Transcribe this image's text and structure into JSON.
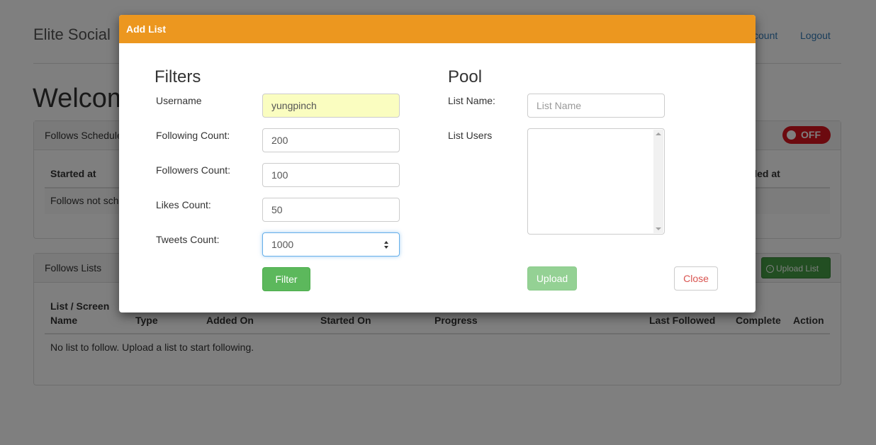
{
  "app": {
    "brand": "Elite Social",
    "nav": {
      "account": "count",
      "logout": "Logout"
    },
    "welcome": "Welcom"
  },
  "schedule_panel": {
    "title": "Follows Schedule",
    "toggle_label": "OFF",
    "columns": {
      "started": "Started at",
      "ended": "nded at"
    },
    "empty_text": "Follows not sch"
  },
  "lists_panel": {
    "title": "Follows Lists",
    "upload_button": "Upload List",
    "columns": {
      "list_line1": "List / Screen",
      "list_line2": "Name",
      "type": "Type",
      "added_on": "Added On",
      "started_on": "Started On",
      "progress": "Progress",
      "last_followed": "Last Followed",
      "complete": "Complete",
      "action": "Action"
    },
    "empty_text": "No list to follow. Upload a list to start following."
  },
  "modal": {
    "title": "Add List",
    "filters": {
      "heading": "Filters",
      "username_label": "Username",
      "username_value": "yungpinch",
      "following_label": "Following Count:",
      "following_value": "200",
      "followers_label": "Followers Count:",
      "followers_value": "100",
      "likes_label": "Likes Count:",
      "likes_value": "50",
      "tweets_label": "Tweets Count:",
      "tweets_value": "1000",
      "filter_button": "Filter"
    },
    "pool": {
      "heading": "Pool",
      "list_name_label": "List Name:",
      "list_name_placeholder": "List Name",
      "list_users_label": "List Users",
      "upload_button": "Upload",
      "close_button": "Close"
    }
  },
  "colors": {
    "modal_header": "#ec971f",
    "success": "#5cb85c",
    "danger": "#d9534f",
    "link": "#337ab7"
  }
}
